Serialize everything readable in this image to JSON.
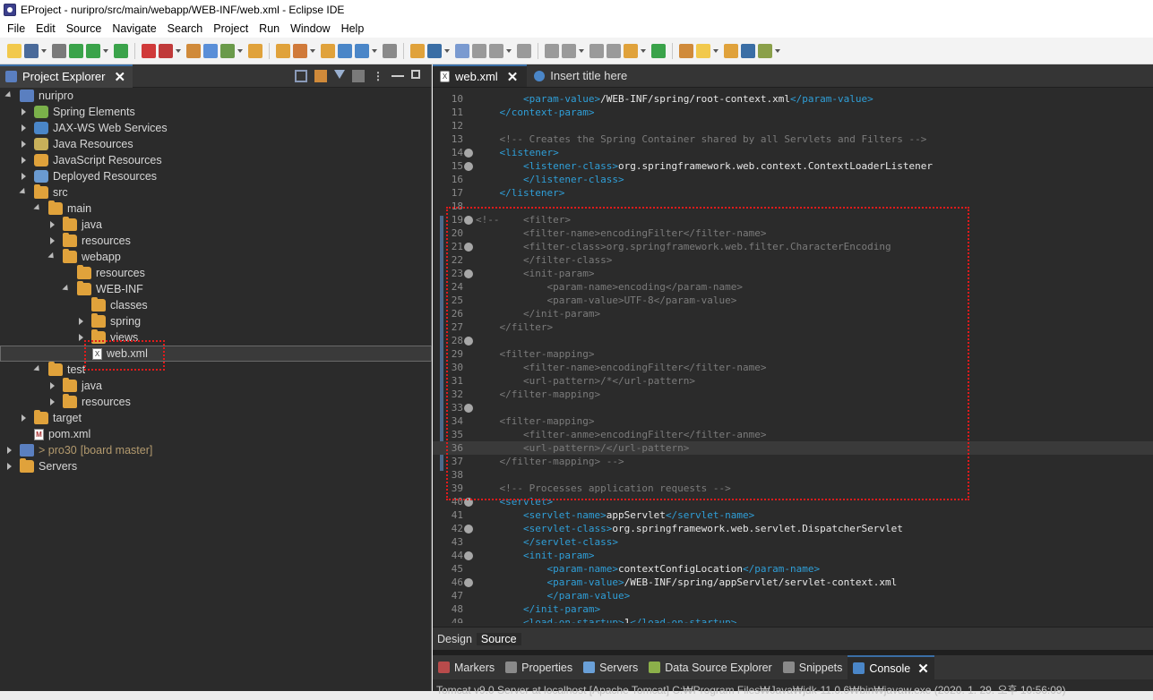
{
  "window": {
    "title": "EProject - nuripro/src/main/webapp/WEB-INF/web.xml - Eclipse IDE"
  },
  "menu": [
    "File",
    "Edit",
    "Source",
    "Navigate",
    "Search",
    "Project",
    "Run",
    "Window",
    "Help"
  ],
  "explorer": {
    "tab_label": "Project Explorer",
    "items": [
      {
        "label": "nuripro",
        "depth": 0,
        "twisty": "e",
        "icon": "proj"
      },
      {
        "label": "Spring Elements",
        "depth": 1,
        "twisty": "c",
        "icon": "spring"
      },
      {
        "label": "JAX-WS Web Services",
        "depth": 1,
        "twisty": "c",
        "icon": "ws"
      },
      {
        "label": "Java Resources",
        "depth": 1,
        "twisty": "c",
        "icon": "jres"
      },
      {
        "label": "JavaScript Resources",
        "depth": 1,
        "twisty": "c",
        "icon": "js"
      },
      {
        "label": "Deployed Resources",
        "depth": 1,
        "twisty": "c",
        "icon": "deploy"
      },
      {
        "label": "src",
        "depth": 1,
        "twisty": "e",
        "icon": "folder"
      },
      {
        "label": "main",
        "depth": 2,
        "twisty": "e",
        "icon": "folder"
      },
      {
        "label": "java",
        "depth": 3,
        "twisty": "c",
        "icon": "folder"
      },
      {
        "label": "resources",
        "depth": 3,
        "twisty": "c",
        "icon": "folder"
      },
      {
        "label": "webapp",
        "depth": 3,
        "twisty": "e",
        "icon": "folder"
      },
      {
        "label": "resources",
        "depth": 4,
        "twisty": "",
        "icon": "folder"
      },
      {
        "label": "WEB-INF",
        "depth": 4,
        "twisty": "e",
        "icon": "folder"
      },
      {
        "label": "classes",
        "depth": 5,
        "twisty": "",
        "icon": "folder"
      },
      {
        "label": "spring",
        "depth": 5,
        "twisty": "c",
        "icon": "folder"
      },
      {
        "label": "views",
        "depth": 5,
        "twisty": "c",
        "icon": "folder"
      },
      {
        "label": "web.xml",
        "depth": 5,
        "twisty": "",
        "icon": "xml",
        "selected": true
      },
      {
        "label": "test",
        "depth": 2,
        "twisty": "e",
        "icon": "folder"
      },
      {
        "label": "java",
        "depth": 3,
        "twisty": "c",
        "icon": "folder"
      },
      {
        "label": "resources",
        "depth": 3,
        "twisty": "c",
        "icon": "folder"
      },
      {
        "label": "target",
        "depth": 1,
        "twisty": "c",
        "icon": "folder"
      },
      {
        "label": "pom.xml",
        "depth": 1,
        "twisty": "",
        "icon": "mvn"
      },
      {
        "label": "> pro30",
        "depth": 0,
        "twisty": "c",
        "icon": "proj",
        "git": "[board master]"
      },
      {
        "label": "Servers",
        "depth": 0,
        "twisty": "c",
        "icon": "folder"
      }
    ]
  },
  "editor": {
    "tabs": [
      {
        "label": "web.xml",
        "active": true
      },
      {
        "label": "Insert title here",
        "active": false
      }
    ],
    "bottom_tabs": [
      "Design",
      "Source"
    ],
    "active_bottom_tab": "Source",
    "lines": [
      {
        "n": "10",
        "fold": false,
        "text": "        <param-value>/WEB-INF/spring/root-context.xml</param-value>"
      },
      {
        "n": "11",
        "fold": false,
        "text": "    </context-param>"
      },
      {
        "n": "12",
        "fold": false,
        "text": ""
      },
      {
        "n": "13",
        "fold": false,
        "text": "    <!-- Creates the Spring Container shared by all Servlets and Filters -->"
      },
      {
        "n": "14",
        "fold": true,
        "text": "    <listener>"
      },
      {
        "n": "15",
        "fold": true,
        "text": "        <listener-class>org.springframework.web.context.ContextLoaderListener"
      },
      {
        "n": "16",
        "fold": false,
        "text": "        </listener-class>"
      },
      {
        "n": "17",
        "fold": false,
        "text": "    </listener>"
      },
      {
        "n": "18",
        "fold": false,
        "text": ""
      },
      {
        "n": "19",
        "fold": true,
        "text": "<!--    <filter>"
      },
      {
        "n": "20",
        "fold": false,
        "text": "        <filter-name>encodingFilter</filter-name>"
      },
      {
        "n": "21",
        "fold": true,
        "text": "        <filter-class>org.springframework.web.filter.CharacterEncoding"
      },
      {
        "n": "22",
        "fold": false,
        "text": "        </filter-class>"
      },
      {
        "n": "23",
        "fold": true,
        "text": "        <init-param>"
      },
      {
        "n": "24",
        "fold": false,
        "text": "            <param-name>encoding</param-name>"
      },
      {
        "n": "25",
        "fold": false,
        "text": "            <param-value>UTF-8</param-value>"
      },
      {
        "n": "26",
        "fold": false,
        "text": "        </init-param>"
      },
      {
        "n": "27",
        "fold": false,
        "text": "    </filter>"
      },
      {
        "n": "28",
        "fold": true,
        "text": ""
      },
      {
        "n": "29",
        "fold": false,
        "text": "    <filter-mapping>"
      },
      {
        "n": "30",
        "fold": false,
        "text": "        <filter-name>encodingFilter</filter-name>"
      },
      {
        "n": "31",
        "fold": false,
        "text": "        <url-pattern>/*</url-pattern>"
      },
      {
        "n": "32",
        "fold": false,
        "text": "    </filter-mapping>"
      },
      {
        "n": "33",
        "fold": true,
        "text": ""
      },
      {
        "n": "34",
        "fold": false,
        "text": "    <filter-mapping>"
      },
      {
        "n": "35",
        "fold": false,
        "text": "        <filter-anme>encodingFilter</filter-anme>"
      },
      {
        "n": "36",
        "fold": false,
        "text": "        <url-pattern>/</url-pattern>",
        "current": true
      },
      {
        "n": "37",
        "fold": false,
        "text": "    </filter-mapping> -->"
      },
      {
        "n": "38",
        "fold": false,
        "text": ""
      },
      {
        "n": "39",
        "fold": false,
        "text": "    <!-- Processes application requests -->"
      },
      {
        "n": "40",
        "fold": true,
        "text": "    <servlet>"
      },
      {
        "n": "41",
        "fold": false,
        "text": "        <servlet-name>appServlet</servlet-name>"
      },
      {
        "n": "42",
        "fold": true,
        "text": "        <servlet-class>org.springframework.web.servlet.DispatcherServlet"
      },
      {
        "n": "43",
        "fold": false,
        "text": "        </servlet-class>"
      },
      {
        "n": "44",
        "fold": true,
        "text": "        <init-param>"
      },
      {
        "n": "45",
        "fold": false,
        "text": "            <param-name>contextConfigLocation</param-name>"
      },
      {
        "n": "46",
        "fold": true,
        "text": "            <param-value>/WEB-INF/spring/appServlet/servlet-context.xml"
      },
      {
        "n": "47",
        "fold": false,
        "text": "            </param-value>"
      },
      {
        "n": "48",
        "fold": false,
        "text": "        </init-param>"
      },
      {
        "n": "49",
        "fold": false,
        "text": "        <load-on-startup>1</load-on-startup>"
      }
    ]
  },
  "bottom_panel": {
    "tabs": [
      {
        "label": "Markers",
        "color": "#b84b4b"
      },
      {
        "label": "Properties",
        "color": "#8a8a8a"
      },
      {
        "label": "Servers",
        "color": "#6aa0d8"
      },
      {
        "label": "Data Source Explorer",
        "color": "#8cb04a"
      },
      {
        "label": "Snippets",
        "color": "#8a8a8a"
      },
      {
        "label": "Console",
        "color": "#4a86c8",
        "active": true
      }
    ],
    "console_text": "Tomcat v9.0 Server at localhost [Apache Tomcat] C:₩Program Files₩Java₩jdk-11.0.6₩bin₩javaw.exe (2020. 1. 29. 오후 10:56:09)"
  },
  "colors": {
    "accent": "#3a6ea5",
    "annotation": "#e21b1b",
    "tag": "#2f9fd8",
    "comment": "#7b7b7b"
  }
}
